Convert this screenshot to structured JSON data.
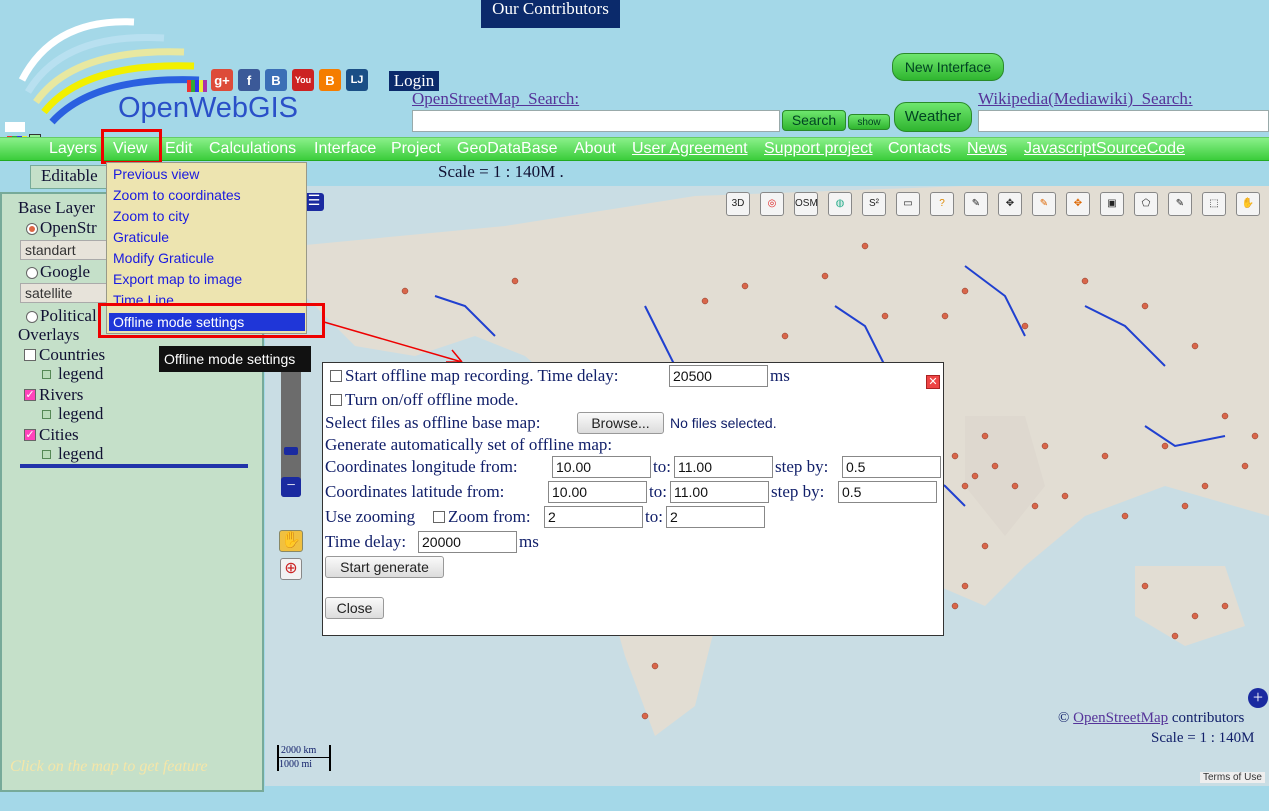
{
  "header": {
    "contributors_label": "Our Contributors",
    "logo_text": "OpenWebGIS",
    "login_label": "Login",
    "osm_search_label": "OpenStreetMap_Search:",
    "search_button": "Search",
    "show_button": "show",
    "new_interface_button": "New Interface",
    "weather_button": "Weather",
    "wiki_search_label": "Wikipedia(Mediawiki)_Search:",
    "social_icons": [
      {
        "icon": "google-plus-icon",
        "glyph": "g+",
        "color": "#dd4b39"
      },
      {
        "icon": "facebook-icon",
        "glyph": "f",
        "color": "#3b5998"
      },
      {
        "icon": "blogger-b-icon",
        "glyph": "B",
        "color": "#3b6fb6"
      },
      {
        "icon": "youtube-icon",
        "glyph": "You",
        "color": "#cc2222"
      },
      {
        "icon": "blogger-icon",
        "glyph": "B",
        "color": "#f57d00"
      },
      {
        "icon": "livejournal-icon",
        "glyph": "LJ",
        "color": "#1a4f86"
      }
    ]
  },
  "menu": {
    "items": [
      "Layers",
      "View",
      "Edit",
      "Calculations",
      "Interface",
      "Project",
      "GeoDataBase",
      "About",
      "User Agreement",
      "Support project",
      "Contacts",
      "News",
      "JavascriptSourceCode"
    ],
    "scale_text": "Scale = 1 : 140M",
    "editable_label": "Editable"
  },
  "view_dropdown": {
    "items": [
      "Previous view",
      "Zoom to coordinates",
      "Zoom to city",
      "Graticule",
      "Modify Graticule",
      "Export map to image",
      "Time Line"
    ],
    "selected": "Offline mode settings",
    "tooltip": "Offline mode settings"
  },
  "sidebar": {
    "base_layers_label": "Base Layer",
    "osm_option": "OpenStr",
    "osm_select_value": "standart",
    "google_option": "Google",
    "google_select_value": "satellite",
    "political_option": "Political",
    "overlays_label": "Overlays",
    "countries": "Countries",
    "rivers": "Rivers",
    "cities": "Cities",
    "legend": "legend",
    "hint": "Click on the map to get feature"
  },
  "map": {
    "attribution_prefix": "© ",
    "attribution_link": "OpenStreetMap",
    "attribution_suffix": " contributors",
    "scale_text": "Scale = 1 : 140M",
    "scalebar_km": "2000 km",
    "scalebar_mi": "1000 mi",
    "terms": "Terms of Use",
    "tools": [
      "3D",
      "target",
      "OSM",
      "globe",
      "S²",
      "ruler",
      "?",
      "draw",
      "pan",
      "edit",
      "move",
      "save",
      "polygon",
      "select",
      "box",
      "hand"
    ]
  },
  "offline_dialog": {
    "start_recording_label": "Start offline map recording. Time delay:",
    "recording_delay_value": "20500",
    "ms": "ms",
    "toggle_offline_label": "Turn on/off offline mode.",
    "select_files_label": "Select files as offline base map:",
    "browse_button": "Browse...",
    "no_files": "No files selected.",
    "generate_label": "Generate automatically set of offline map:",
    "lon_label": "Coordinates longitude from:",
    "lon_from": "10.00",
    "to_label": "to:",
    "lon_to": "11.00",
    "step_label": "step by:",
    "lon_step": "0.5",
    "lat_label": "Coordinates latitude from:",
    "lat_from": "10.00",
    "lat_to": "11.00",
    "lat_step": "0.5",
    "use_zooming_label": "Use zooming",
    "zoom_from_label": "Zoom from:",
    "zoom_from": "2",
    "zoom_to": "2",
    "time_delay_label": "Time delay:",
    "time_delay_value": "20000",
    "start_generate_button": "Start generate",
    "close_button": "Close"
  }
}
